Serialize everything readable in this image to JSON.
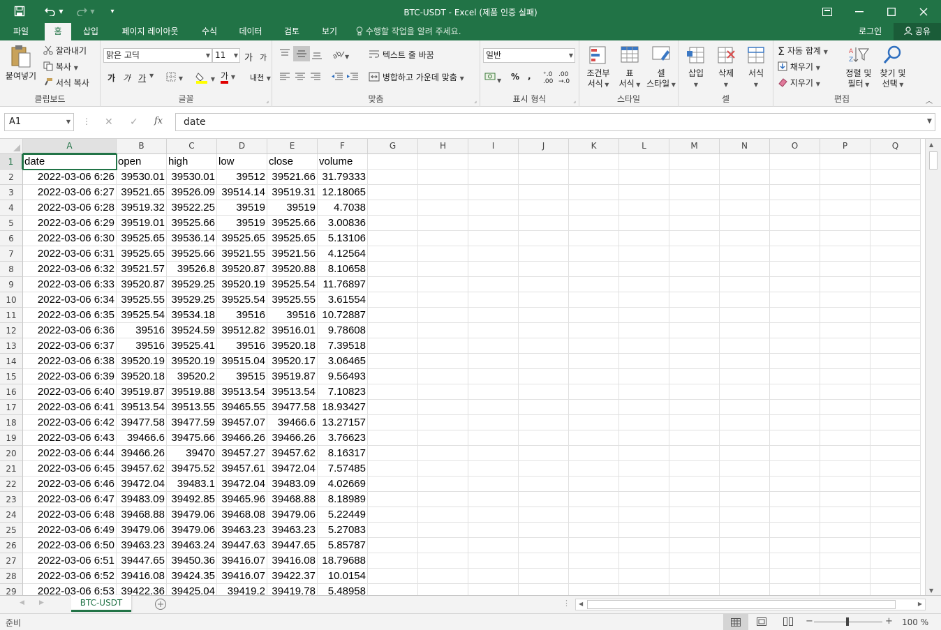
{
  "window": {
    "title": "BTC-USDT - Excel (제품 인증 실패)"
  },
  "ribbon_tabs": [
    "파일",
    "홈",
    "삽입",
    "페이지 레이아웃",
    "수식",
    "데이터",
    "검토",
    "보기"
  ],
  "tell_me": "수행할 작업을 알려 주세요.",
  "account": {
    "login": "로그인",
    "share": "공유"
  },
  "clipboard": {
    "paste": "붙여넣기",
    "cut": "잘라내기",
    "copy": "복사",
    "format_painter": "서식 복사",
    "label": "클립보드"
  },
  "font": {
    "name": "맑은 고딕",
    "size": "11",
    "grow": "가",
    "shrink": "가",
    "bold": "가",
    "italic": "가",
    "underline": "가",
    "color_letter": "가",
    "phonetic": "내천",
    "label": "글꼴"
  },
  "alignment": {
    "wrap_text": "텍스트 줄 바꿈",
    "merge_center": "병합하고 가운데 맞춤",
    "label": "맞춤"
  },
  "number": {
    "format": "일반",
    "percent": "%",
    "comma": ",",
    "label": "표시 형식"
  },
  "styles": {
    "conditional_1": "조건부",
    "conditional_2": "서식",
    "table_1": "표",
    "table_2": "서식",
    "cell_1": "셀",
    "cell_2": "스타일",
    "label": "스타일"
  },
  "cells": {
    "insert": "삽입",
    "delete": "삭제",
    "format": "서식",
    "label": "셀"
  },
  "editing": {
    "autosum": "자동 합계",
    "fill": "채우기",
    "clear": "지우기",
    "sort_1": "정렬 및",
    "sort_2": "필터",
    "find_1": "찾기 및",
    "find_2": "선택",
    "label": "편집"
  },
  "formula_bar": {
    "name_box": "A1",
    "content": "date",
    "fx": "fx"
  },
  "columns": [
    "A",
    "B",
    "C",
    "D",
    "E",
    "F",
    "G",
    "H",
    "I",
    "J",
    "K",
    "L",
    "M",
    "N",
    "O",
    "P",
    "Q"
  ],
  "header_row": [
    "date",
    "open",
    "high",
    "low",
    "close",
    "volume"
  ],
  "rows": [
    [
      "2022-03-06 6:26",
      "39530.01",
      "39530.01",
      "39512",
      "39521.66",
      "31.79333"
    ],
    [
      "2022-03-06 6:27",
      "39521.65",
      "39526.09",
      "39514.14",
      "39519.31",
      "12.18065"
    ],
    [
      "2022-03-06 6:28",
      "39519.32",
      "39522.25",
      "39519",
      "39519",
      "4.7038"
    ],
    [
      "2022-03-06 6:29",
      "39519.01",
      "39525.66",
      "39519",
      "39525.66",
      "3.00836"
    ],
    [
      "2022-03-06 6:30",
      "39525.65",
      "39536.14",
      "39525.65",
      "39525.65",
      "5.13106"
    ],
    [
      "2022-03-06 6:31",
      "39525.65",
      "39525.66",
      "39521.55",
      "39521.56",
      "4.12564"
    ],
    [
      "2022-03-06 6:32",
      "39521.57",
      "39526.8",
      "39520.87",
      "39520.88",
      "8.10658"
    ],
    [
      "2022-03-06 6:33",
      "39520.87",
      "39529.25",
      "39520.19",
      "39525.54",
      "11.76897"
    ],
    [
      "2022-03-06 6:34",
      "39525.55",
      "39529.25",
      "39525.54",
      "39525.55",
      "3.61554"
    ],
    [
      "2022-03-06 6:35",
      "39525.54",
      "39534.18",
      "39516",
      "39516",
      "10.72887"
    ],
    [
      "2022-03-06 6:36",
      "39516",
      "39524.59",
      "39512.82",
      "39516.01",
      "9.78608"
    ],
    [
      "2022-03-06 6:37",
      "39516",
      "39525.41",
      "39516",
      "39520.18",
      "7.39518"
    ],
    [
      "2022-03-06 6:38",
      "39520.19",
      "39520.19",
      "39515.04",
      "39520.17",
      "3.06465"
    ],
    [
      "2022-03-06 6:39",
      "39520.18",
      "39520.2",
      "39515",
      "39519.87",
      "9.56493"
    ],
    [
      "2022-03-06 6:40",
      "39519.87",
      "39519.88",
      "39513.54",
      "39513.54",
      "7.10823"
    ],
    [
      "2022-03-06 6:41",
      "39513.54",
      "39513.55",
      "39465.55",
      "39477.58",
      "18.93427"
    ],
    [
      "2022-03-06 6:42",
      "39477.58",
      "39477.59",
      "39457.07",
      "39466.6",
      "13.27157"
    ],
    [
      "2022-03-06 6:43",
      "39466.6",
      "39475.66",
      "39466.26",
      "39466.26",
      "3.76623"
    ],
    [
      "2022-03-06 6:44",
      "39466.26",
      "39470",
      "39457.27",
      "39457.62",
      "8.16317"
    ],
    [
      "2022-03-06 6:45",
      "39457.62",
      "39475.52",
      "39457.61",
      "39472.04",
      "7.57485"
    ],
    [
      "2022-03-06 6:46",
      "39472.04",
      "39483.1",
      "39472.04",
      "39483.09",
      "4.02669"
    ],
    [
      "2022-03-06 6:47",
      "39483.09",
      "39492.85",
      "39465.96",
      "39468.88",
      "8.18989"
    ],
    [
      "2022-03-06 6:48",
      "39468.88",
      "39479.06",
      "39468.08",
      "39479.06",
      "5.22449"
    ],
    [
      "2022-03-06 6:49",
      "39479.06",
      "39479.06",
      "39463.23",
      "39463.23",
      "5.27083"
    ],
    [
      "2022-03-06 6:50",
      "39463.23",
      "39463.24",
      "39447.63",
      "39447.65",
      "5.85787"
    ],
    [
      "2022-03-06 6:51",
      "39447.65",
      "39450.36",
      "39416.07",
      "39416.08",
      "18.79688"
    ],
    [
      "2022-03-06 6:52",
      "39416.08",
      "39424.35",
      "39416.07",
      "39422.37",
      "10.0154"
    ],
    [
      "2022-03-06 6:53",
      "39422.36",
      "39425.04",
      "39419.2",
      "39419.78",
      "5.48958"
    ]
  ],
  "sheet_tab": "BTC-USDT",
  "status": {
    "ready": "준비",
    "zoom": "100 %"
  },
  "colors": {
    "accent": "#217346"
  }
}
